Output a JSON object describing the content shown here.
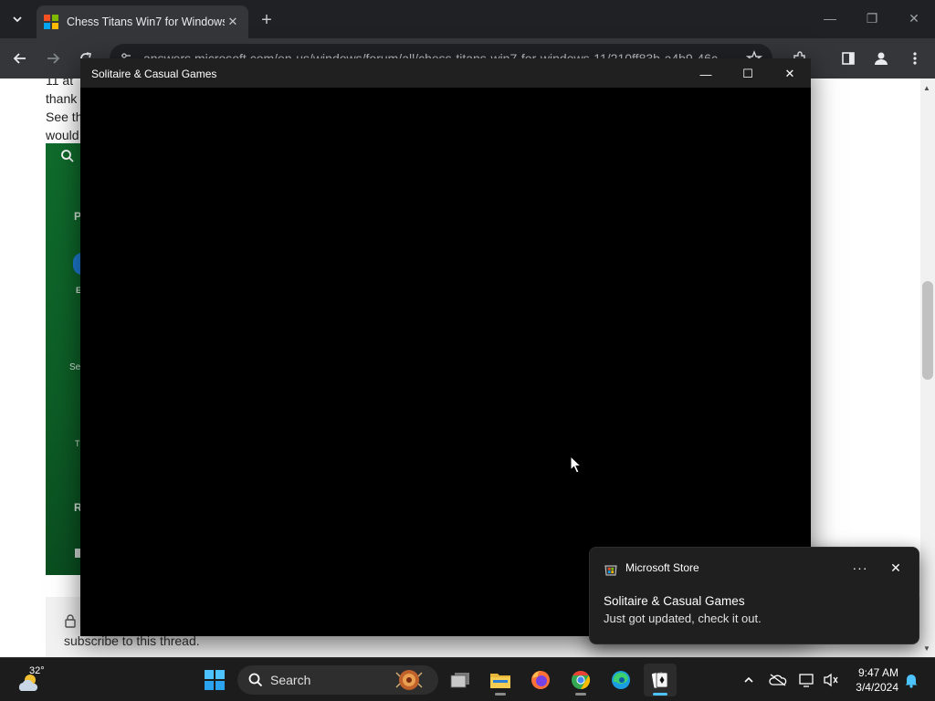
{
  "browser": {
    "tab": {
      "title": "Chess Titans Win7 for Windows",
      "close_glyph": "✕"
    },
    "new_tab_glyph": "+",
    "window_controls": {
      "minimize": "—",
      "restore": "❐",
      "close": "✕"
    },
    "address_bar": {
      "url": "answers.microsoft.com/en-us/windows/forum/all/chess-titans-win7-for-windows-11/210ff83b-a4b9-46c"
    },
    "favicon_colors": [
      "#f25022",
      "#7fba00",
      "#00a4ef",
      "#ffb900"
    ]
  },
  "webpage": {
    "text_lines": [
      "11 at",
      "thank",
      "See th",
      "would"
    ],
    "panel_fragments": [
      "P",
      "E",
      "Se",
      "T",
      "R"
    ],
    "footer_text": "subscribe to this thread."
  },
  "app_window": {
    "title": "Solitaire & Casual Games",
    "controls": {
      "minimize": "—",
      "maximize": "☐",
      "close": "✕"
    },
    "background": "#000000"
  },
  "notification": {
    "app_name": "Microsoft Store",
    "more_glyph": "···",
    "close_glyph": "✕",
    "headline": "Solitaire & Casual Games",
    "message": "Just got updated, check it out."
  },
  "taskbar": {
    "weather": {
      "temperature": "32°"
    },
    "search": {
      "label": "Search"
    },
    "clock": {
      "time": "9:47 AM",
      "date": "3/4/2024"
    },
    "pinned": [
      "start-icon",
      "task-view-icon",
      "file-explorer-icon",
      "firefox-icon",
      "chrome-icon",
      "edge-icon",
      "solitaire-icon"
    ],
    "accent": "#4cc2ff"
  }
}
